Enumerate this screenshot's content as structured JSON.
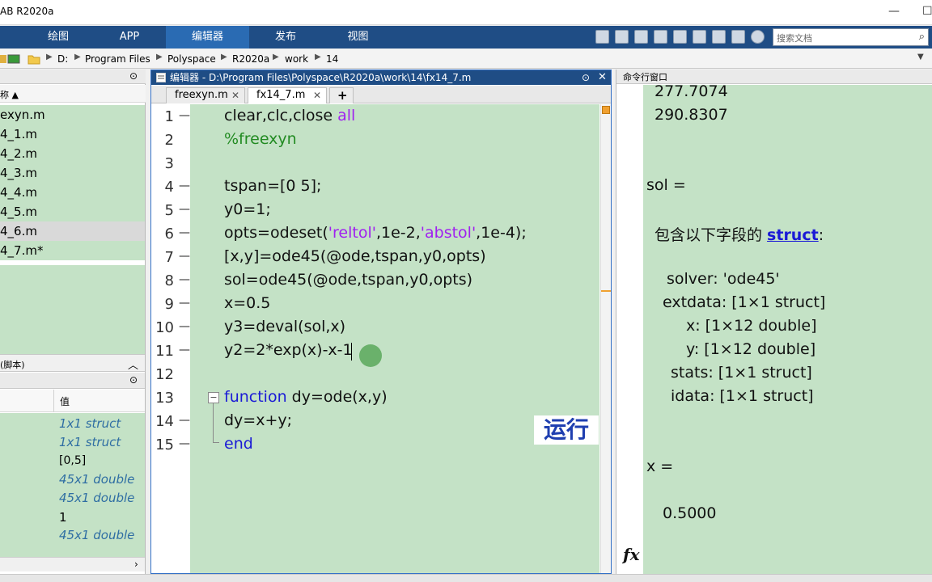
{
  "window": {
    "title": "AB R2020a"
  },
  "ribbon": {
    "tabs": [
      {
        "label": "绘图"
      },
      {
        "label": "APP"
      },
      {
        "label": "编辑器"
      },
      {
        "label": "发布"
      },
      {
        "label": "视图"
      }
    ],
    "search_placeholder": "搜索文档"
  },
  "address": {
    "crumbs": [
      "D:",
      "Program Files",
      "Polyspace",
      "R2020a",
      "work",
      "14"
    ]
  },
  "current_folder": {
    "header": "",
    "col_name": "称 ▲",
    "files": [
      "exyn.m",
      "4_1.m",
      "4_2.m",
      "4_3.m",
      "4_4.m",
      "4_5.m",
      "4_6.m",
      "4_7.m*"
    ],
    "selected_index": 6,
    "details_label": "(脚本)"
  },
  "workspace": {
    "col_value": "值",
    "values": [
      {
        "text": "1x1 struct",
        "kind": "struct"
      },
      {
        "text": "1x1 struct",
        "kind": "struct"
      },
      {
        "text": "[0,5]",
        "kind": "plain"
      },
      {
        "text": "45x1 double",
        "kind": "struct"
      },
      {
        "text": "45x1 double",
        "kind": "struct"
      },
      {
        "text": "1",
        "kind": "plain"
      },
      {
        "text": "45x1 double",
        "kind": "struct"
      }
    ]
  },
  "editor": {
    "title": "编辑器 - D:\\Program Files\\Polyspace\\R2020a\\work\\14\\fx14_7.m",
    "tabs": [
      {
        "label": "freexyn.m"
      },
      {
        "label": "fx14_7.m"
      },
      {
        "label": "+"
      }
    ],
    "lines": [
      "1",
      "2",
      "3",
      "4",
      "5",
      "6",
      "7",
      "8",
      "9",
      "10",
      "11",
      "12",
      "13",
      "14",
      "15"
    ],
    "code": {
      "l1a": "clear,clc,close ",
      "l1b": "all",
      "l2": "%freexyn",
      "l4": "tspan=[0 5];",
      "l5": "y0=1;",
      "l6a": "opts=odeset(",
      "l6b": "'reltol'",
      "l6c": ",1e-2,",
      "l6d": "'abstol'",
      "l6e": ",1e-4);",
      "l7": "[x,y]=ode45(@ode,tspan,y0,opts)",
      "l8": "sol=ode45(@ode,tspan,y0,opts)",
      "l9": "x=0.5",
      "l10": "y3=deval(sol,x)",
      "l11": "y2=2*exp(x)-x-1",
      "l13a": "function",
      "l13b": " dy=ode(x,y)",
      "l14": "dy=x+y;",
      "l15": "end"
    },
    "overlay_label": "运行"
  },
  "command_window": {
    "header": "命令行窗口",
    "out": {
      "v1": "277.7074",
      "v2": "290.8307",
      "sol": "sol =",
      "contains": "包含以下字段的 ",
      "struct_link": "struct",
      "colon": ":",
      "f1": "solver: 'ode45'",
      "f2": "extdata: [1×1 struct]",
      "f3": "x: [1×12 double]",
      "f4": "y: [1×12 double]",
      "f5": "stats: [1×1 struct]",
      "f6": "idata: [1×1 struct]",
      "x": "x =",
      "xval": "0.5000"
    },
    "prompt": "fx"
  },
  "colors": {
    "code_bg": "#c4e2c6",
    "ribbon": "#1f4d85",
    "keyword": "#1a1ad6",
    "string": "#a020f0",
    "comment": "#228b22"
  }
}
